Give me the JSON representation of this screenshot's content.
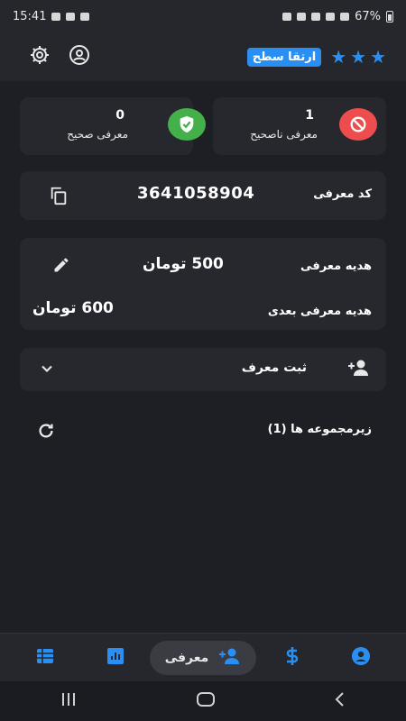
{
  "status": {
    "time": "15:41",
    "battery": "67%"
  },
  "header": {
    "upgrade_label": "ارتقا سطح",
    "stars": [
      "★",
      "★",
      "★"
    ],
    "icons": [
      "settings-icon",
      "account-circle-icon"
    ]
  },
  "stats": {
    "valid": {
      "value": "0",
      "label": "معرفی صحیح",
      "icon": "shield-check-icon",
      "color": "#43b04a"
    },
    "invalid": {
      "value": "1",
      "label": "معرفی ناصحیح",
      "icon": "block-icon",
      "color": "#ee4d4d"
    }
  },
  "referral": {
    "code_label": "کد معرفی",
    "code_value": "3641058904"
  },
  "gift": {
    "current_label": "هدیه معرفی",
    "current_value": "500 تومان",
    "next_label": "هدیه معرفی بعدی",
    "next_value": "600 تومان"
  },
  "register": {
    "label": "ثبت معرف"
  },
  "subgroups": {
    "label": "زیرمجموعه ها (1)"
  },
  "bottom_nav": {
    "active_label": "معرفی",
    "items": [
      "table-icon",
      "chart-icon",
      "referral-icon",
      "dollar-icon",
      "account-icon"
    ]
  },
  "colors": {
    "accent": "#2a8ff3",
    "background": "#1e1f25",
    "card": "#27282e"
  }
}
